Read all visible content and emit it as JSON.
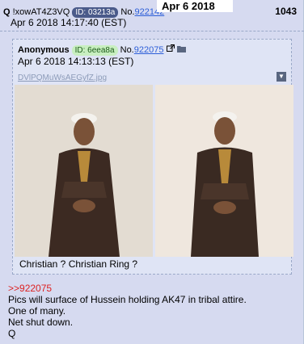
{
  "header": {
    "trip_prefix": "Q",
    "tripcode": "!xowAT4Z3VQ",
    "id": "ID: 03213a",
    "no_label": "No.",
    "post_no": "922142",
    "datetime": "Apr 6 2018 14:17:40 (EST)",
    "overlay_date": "Apr 6 2018",
    "post_counter": "1043"
  },
  "quoted": {
    "name": "Anonymous",
    "id": "ID: 6eea8a",
    "no_label": "No.",
    "post_no": "922075",
    "datetime": "Apr 6 2018 14:13:13 (EST)",
    "filename": "DVlPQMuWsAEGyfZ.jpg",
    "caption": "Christian ? Christian Ring ?"
  },
  "body": {
    "quote_link": ">>922075",
    "lines": [
      "Pics will surface of Hussein holding AK47 in tribal attire.",
      "One of many.",
      "Net shut down.",
      "Q"
    ]
  }
}
